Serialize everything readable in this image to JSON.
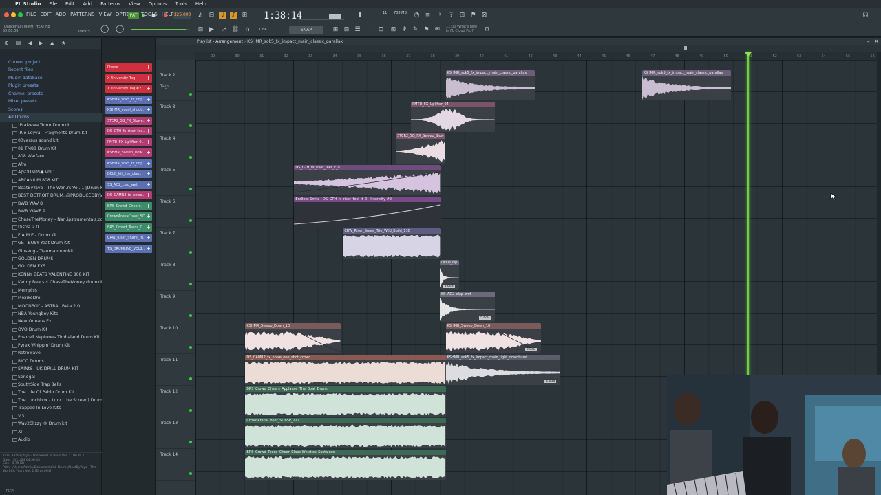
{
  "menubar": {
    "app": "FL Studio",
    "items": [
      "File",
      "Edit",
      "Add",
      "Patterns",
      "View",
      "Options",
      "Tools",
      "Help"
    ]
  },
  "toolbar": {
    "fl_menu": [
      "FILE",
      "EDIT",
      "ADD",
      "PATTERNS",
      "VIEW",
      "OPTIONS",
      "TOOLS",
      "HELP"
    ],
    "pat_label": "PAT",
    "song_label": "SONG",
    "tempo": "125.000",
    "song_time": "1:38:14",
    "pattern": "Track 5",
    "snap": "SNAP",
    "line": "Line",
    "project_info": "[DanceHall] MIAMI HEAT flp\n55:08:00",
    "cpu": "11",
    "mem": "788 MB",
    "news": "11:00 What's new\nin FL Cloud Pro?"
  },
  "browser": {
    "categories": [
      {
        "label": "Current project",
        "type": "cat"
      },
      {
        "label": "Recent files",
        "type": "cat"
      },
      {
        "label": "Plugin database",
        "type": "cat"
      },
      {
        "label": "Plugin presets",
        "type": "cat"
      },
      {
        "label": "Channel presets",
        "type": "cat"
      },
      {
        "label": "Mixer presets",
        "type": "cat"
      },
      {
        "label": "Scores",
        "type": "cat"
      },
      {
        "label": "All Drums",
        "type": "root"
      }
    ],
    "folders": [
      "!Praizewa Tomo Drumkit",
      "!Rio Leyva - Fragments Drum Kit",
      "00versus sound kit",
      "01 TM88 Drum Kit",
      "808 Warfare",
      "Afro",
      "AJSOUNDS◆ Vol.1",
      "ARCANIUM 808 KIT",
      "BeatByYayo - The Wor..rs Vol. 1 [Drum Kit]",
      "BEST DETROIT DRUM..@PRODUCEDBYJAVEN",
      "BWB WAV 8",
      "BWB WAVE 9",
      "ChaseTheMoney - Nar..ipstrumentals.com)",
      "Distra 2.0",
      "F A M E - Drum Kit",
      "GET BUSY Yeat Drum Kit",
      "Ginseng - Trauma drumkit",
      "GOLDEN DRUMS",
      "GOLDEN FXS",
      "KENNY BEATS VALENTINE 808 KIT",
      "Kenny Beats x ChaseTheMoney drumkit",
      "Memphis",
      "MexikoDro",
      "MOONBOY - ASTRAL Beta 2.0",
      "NBA Youngboy Kits",
      "New Orleans Fx",
      "OVO Drum Kit",
      "Pharrell Neptunes Timbaland Drum Kit",
      "Pyrex Whippin' Drum Kit",
      "Retrowave",
      "RICO Drums",
      "SAINt6 - UK DRILL DRUM KIT",
      "Senegal",
      "SouthSide Trap Bells",
      "The Life Of Pablo Drum Kit",
      "The Lunchbox - Lunc..the Screen) Drumkit",
      "Trapped In Love Kits",
      "V.3",
      "Wav2Slizzy ® Drum kit",
      "XI",
      "Audio"
    ],
    "info": "Title  BeatByYayo - The World Is Yours Vol. 1 [Drum K..\nDate   5/11/24 04:56:43\nSize   9.79 KB\nPath   /Users/Admin/Documents/All Drums/BeatByYayo - The World Is Yours Vol. 1 [Drum Kit]",
    "tags": "TAGS"
  },
  "channels": [
    {
      "label": "Phone",
      "color": "#d02f3f"
    },
    {
      "label": "X University Tag",
      "color": "#d02f3f"
    },
    {
      "label": "X University Tag #2",
      "color": "#d02f3f"
    },
    {
      "label": "KSHMR_sok5_fx_imp..",
      "color": "#5b6fb3"
    },
    {
      "label": "KSHMR_vocal_shout..",
      "color": "#5b6fb3"
    },
    {
      "label": "STCR2_SG_FX_Slowe..",
      "color": "#b33c72"
    },
    {
      "label": "DS_GTH_fx_riser_fee..",
      "color": "#b33c72"
    },
    {
      "label": "PMTD_FX_Uplifter_0..",
      "color": "#b33c72"
    },
    {
      "label": "KSHMR_Sweep_Dow..",
      "color": "#b33c72"
    },
    {
      "label": "KSHMR_sok5_fx_imp..",
      "color": "#5b6fb3"
    },
    {
      "label": "DELO_kit_like_clap..",
      "color": "#5b6fb3"
    },
    {
      "label": "SS_AD2_clap_wet",
      "color": "#5b6fb3"
    },
    {
      "label": "DS_CAMR2_fx_noise..",
      "color": "#b33c72"
    },
    {
      "label": "BRS_Crowd_Cheers..",
      "color": "#3d8c6b"
    },
    {
      "label": "CrowdArenaCheer_SO..",
      "color": "#3d8c6b"
    },
    {
      "label": "BRS_Crowd_Teens_C..",
      "color": "#3d8c6b"
    },
    {
      "label": "CRW_Riser_Snare_Tri..",
      "color": "#5b6fb3"
    },
    {
      "label": "TS_DRUMLINE_VOL2..",
      "color": "#5b6fb3"
    }
  ],
  "playlist": {
    "title": "Playlist - Arrangement",
    "pattern": "KSHMR_sok5_fx_impact_main_classic_parallax",
    "tags_label": "Tags",
    "ruler": [
      "29",
      "30",
      "31",
      "32",
      "33",
      "34",
      "35",
      "36",
      "37",
      "38",
      "39",
      "40",
      "41",
      "42",
      "43",
      "44",
      "45",
      "46",
      "47",
      "48",
      "49",
      "50",
      "51",
      "52",
      "53",
      "54",
      "55",
      "56"
    ],
    "tracks": [
      "Track 2",
      "Track 3",
      "Track 4",
      "Track 5",
      "Track 6",
      "Track 7",
      "Track 8",
      "Track 9",
      "Track 10",
      "Track 11",
      "Track 12",
      "Track 13",
      "Track 14"
    ],
    "clips": [
      {
        "label": "KSHMR_sok5_fx_impact_main_classic_parallax",
        "track": 0,
        "start": 38.62,
        "len": 3.65,
        "color": "#c9bed0",
        "cap": "#6a5e78",
        "shape": "impact"
      },
      {
        "label": "KSHMR_sok5_fx_impact_main_classic_parallax",
        "track": 0,
        "start": 46.65,
        "len": 3.65,
        "color": "#c9bed0",
        "cap": "#6a5e78",
        "shape": "impact"
      },
      {
        "label": "PMTD_FX_Uplifter_04",
        "track": 1,
        "start": 37.2,
        "len": 3.42,
        "color": "#e4d8e3",
        "cap": "#7a5468",
        "shape": "swell"
      },
      {
        "label": "STCR2_SG_FX_Sweep_Slow",
        "track": 2,
        "start": 36.58,
        "len": 2.0,
        "color": "#e9dde3",
        "cap": "#7a5468",
        "shape": "rise"
      },
      {
        "label": "DS_GTH_fx_riser_feel_it_0",
        "track": 3,
        "start": 32.42,
        "len": 5.98,
        "color": "#d6c4de",
        "cap": "#6e4d7c",
        "shape": "riser"
      },
      {
        "label": "Endless Smile - DS_GTH_fx_riser_feel_it_0 - Intensity #2",
        "track": 4,
        "start": 32.42,
        "len": 5.98,
        "color": "#2f3339",
        "cap": "#7a4a88",
        "shape": "automation"
      },
      {
        "label": "CRW_Riser_Snare_Trio_Wild_Build_130",
        "track": 5,
        "start": 34.42,
        "len": 3.98,
        "color": "#d7d4e6",
        "cap": "#5d5e82",
        "shape": "noise"
      },
      {
        "label": "DELO_clp",
        "track": 6,
        "start": 38.38,
        "len": 0.78,
        "color": "#e5e5e5",
        "cap": "#6a6a7a",
        "shape": "hit",
        "gain": "5.6dB"
      },
      {
        "label": "SS_AD2_clap_wet",
        "track": 7,
        "start": 38.38,
        "len": 2.26,
        "color": "#e5e5e5",
        "cap": "#6a6a7a",
        "shape": "hit",
        "gain": "5.6dB"
      },
      {
        "label": "KSHMR_Sweep_Down_10",
        "track": 8,
        "start": 30.42,
        "len": 3.9,
        "color": "#f0e2e2",
        "cap": "#7a5a5a",
        "shape": "sweep"
      },
      {
        "label": "KSHMR_Sweep_Down_10",
        "track": 8,
        "start": 38.62,
        "len": 3.9,
        "color": "#f0e2e2",
        "cap": "#7a5a5a",
        "shape": "sweep",
        "gain": "2.0dB"
      },
      {
        "label": "DS_CAMR2_fx_noise_one_shot_crowd",
        "track": 9,
        "start": 30.42,
        "len": 8.2,
        "color": "#ecdcd6",
        "cap": "#8a5a52",
        "shape": "noise"
      },
      {
        "label": "KSHMR_sok5_fx_impact_main_light_downburst",
        "track": 9,
        "start": 38.62,
        "len": 4.7,
        "color": "#dcdde0",
        "cap": "#5a5e6a",
        "shape": "impact",
        "gain": "2.0dB"
      },
      {
        "label": "BRS_Crowd_Cheers_Applause_The_Boat_Drunk",
        "track": 10,
        "start": 30.42,
        "len": 8.2,
        "color": "#cfe3d8",
        "cap": "#3d6a55",
        "shape": "noise"
      },
      {
        "label": "CrowdArenaCheer_SOBSP_222",
        "track": 11,
        "start": 30.42,
        "len": 8.2,
        "color": "#cfe3d8",
        "cap": "#3d6a55",
        "shape": "noise"
      },
      {
        "label": "BRS_Crowd_Teens_Cheer_Claps-Whistles_Sustained",
        "track": 12,
        "start": 30.42,
        "len": 8.2,
        "color": "#cfe3d8",
        "cap": "#3d6a55",
        "shape": "noise"
      }
    ]
  }
}
